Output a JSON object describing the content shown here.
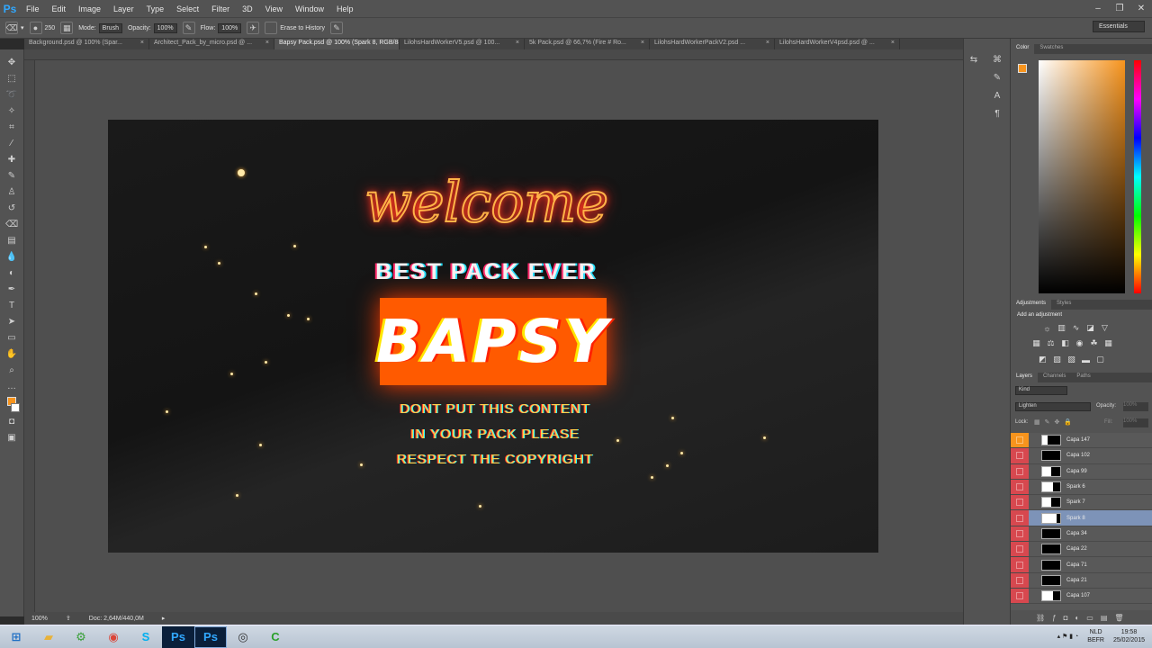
{
  "app": {
    "logo": "Ps"
  },
  "menu": [
    "File",
    "Edit",
    "Image",
    "Layer",
    "Type",
    "Select",
    "Filter",
    "3D",
    "View",
    "Window",
    "Help"
  ],
  "options": {
    "brush_size": "250",
    "mode_label": "Mode:",
    "mode_value": "Brush",
    "opacity_label": "Opacity:",
    "opacity_value": "100%",
    "flow_label": "Flow:",
    "flow_value": "100%",
    "erase_history": "Erase to History",
    "workspace": "Essentials"
  },
  "tabs": [
    {
      "label": "Background.psd @ 100% (Spar...",
      "active": false
    },
    {
      "label": "Architect_Pack_by_micro.psd @ ...",
      "active": false
    },
    {
      "label": "Bapsy Pack.psd @ 100% (Spark 8, RGB/8#) *",
      "active": true
    },
    {
      "label": "LilohsHardWorkerV5.psd @ 100...",
      "active": false
    },
    {
      "label": "5k Pack.psd @ 66,7% (Fire # Ro...",
      "active": false
    },
    {
      "label": "LilohsHardWorkerPackV2.psd ...",
      "active": false
    },
    {
      "label": "LilohsHardWorkerV4psd.psd @ ...",
      "active": false
    }
  ],
  "artwork": {
    "welcome": "welcome",
    "tagline": "BEST PACK EVER",
    "brand": "BAPSY",
    "notice_1": "DONT PUT THIS CONTENT",
    "notice_2": "IN YOUR PACK PLEASE",
    "notice_3": "RESPECT THE COPYRIGHT"
  },
  "status": {
    "zoom": "100%",
    "doc": "Doc: 2,64M/440,0M"
  },
  "panels": {
    "color_tab": "Color",
    "swatches_tab": "Swatches",
    "adjustments_tab": "Adjustments",
    "styles_tab": "Styles",
    "add_adjustment": "Add an adjustment",
    "layers_tab": "Layers",
    "channels_tab": "Channels",
    "paths_tab": "Paths",
    "kind_filter": "Kind",
    "blend_mode": "Lighten",
    "opacity_label": "Opacity:",
    "opacity_value": "100%",
    "lock_label": "Lock:",
    "fill_label": "Fill:",
    "fill_value": "100%"
  },
  "layers": [
    {
      "name": "Capa 147",
      "selected": false
    },
    {
      "name": "Capa 102",
      "selected": false
    },
    {
      "name": "Capa 99",
      "selected": false
    },
    {
      "name": "Spark 6",
      "selected": false
    },
    {
      "name": "Spark 7",
      "selected": false
    },
    {
      "name": "Spark 8",
      "selected": true
    },
    {
      "name": "Capa 34",
      "selected": false
    },
    {
      "name": "Capa 22",
      "selected": false
    },
    {
      "name": "Capa 71",
      "selected": false
    },
    {
      "name": "Capa 21",
      "selected": false
    },
    {
      "name": "Capa 107",
      "selected": false
    }
  ],
  "taskbar": {
    "apps": [
      "explorer",
      "settings",
      "chrome",
      "skype",
      "photoshop",
      "photoshop-active",
      "media",
      "camtasia"
    ],
    "lang_1": "NLD",
    "lang_2": "BEFR",
    "time": "19:58",
    "date": "25/02/2015"
  },
  "colors": {
    "foreground": "#f7941d",
    "background": "#ffffff",
    "accent": "#ff5a00",
    "eye_column": "#d7484f",
    "selected_layer": "#7d93b8"
  }
}
